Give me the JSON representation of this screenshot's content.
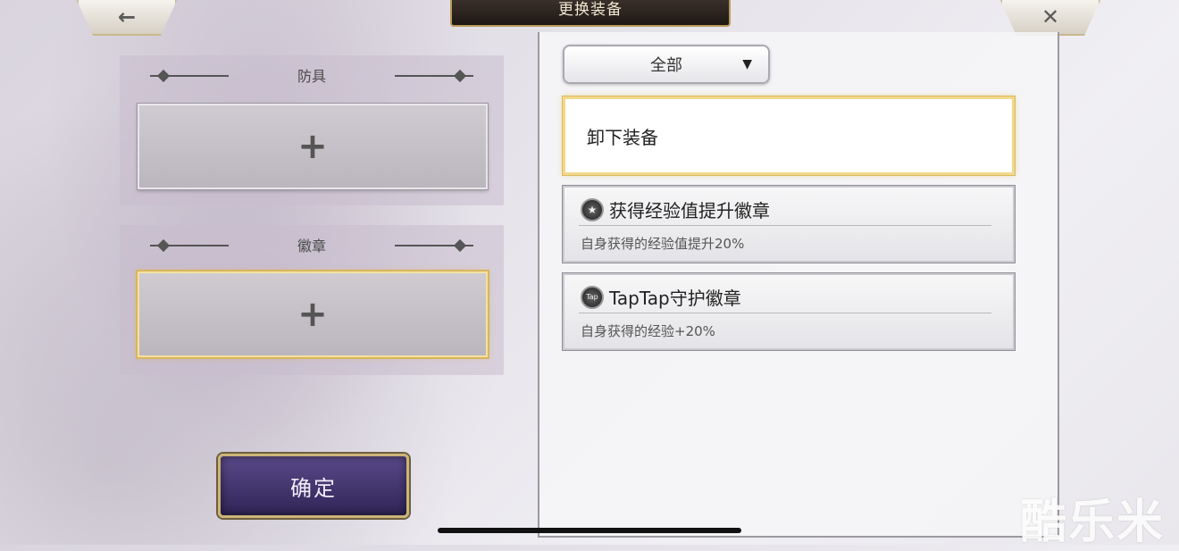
{
  "header": {
    "title": "更换装备",
    "back_icon": "←",
    "close_icon": "✕"
  },
  "slots": {
    "armor": {
      "label": "防具",
      "plus": "+"
    },
    "badge": {
      "label": "徽章",
      "plus": "+"
    }
  },
  "confirm_label": "确定",
  "filter": {
    "value": "全部",
    "arrow": "▼"
  },
  "list": {
    "unequip_label": "卸下装备",
    "items": [
      {
        "icon": "star-badge-icon",
        "icon_glyph": "★",
        "name": "获得经验值提升徽章",
        "desc": "自身获得的经验值提升20%"
      },
      {
        "icon": "taptap-badge-icon",
        "icon_glyph": "Tap",
        "name": "TapTap守护徽章",
        "desc": "自身获得的经验+20%"
      }
    ]
  },
  "watermark": "酷乐米"
}
